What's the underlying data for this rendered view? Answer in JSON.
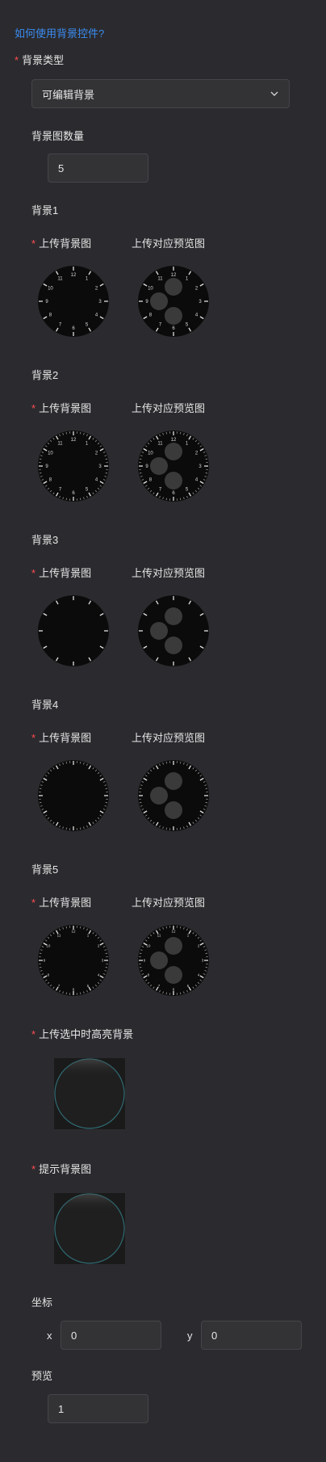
{
  "help_link": "如何使用背景控件?",
  "background_type": {
    "label": "背景类型",
    "value": "可编辑背景"
  },
  "background_count": {
    "label": "背景图数量",
    "value": "5"
  },
  "backgrounds": [
    {
      "title": "背景1",
      "upload_label": "上传背景图",
      "preview_label": "上传对应预览图",
      "dial_style": "numbered"
    },
    {
      "title": "背景2",
      "upload_label": "上传背景图",
      "preview_label": "上传对应预览图",
      "dial_style": "numbered-fine"
    },
    {
      "title": "背景3",
      "upload_label": "上传背景图",
      "preview_label": "上传对应预览图",
      "dial_style": "plain"
    },
    {
      "title": "背景4",
      "upload_label": "上传背景图",
      "preview_label": "上传对应预览图",
      "dial_style": "minute-ticks"
    },
    {
      "title": "背景5",
      "upload_label": "上传背景图",
      "preview_label": "上传对应预览图",
      "dial_style": "numbered-small"
    }
  ],
  "highlight_background": {
    "label": "上传选中时高亮背景"
  },
  "hint_background": {
    "label": "提示背景图"
  },
  "coordinates": {
    "label": "坐标",
    "x_label": "x",
    "x_value": "0",
    "y_label": "y",
    "y_value": "0"
  },
  "preview": {
    "label": "预览",
    "value": "1"
  },
  "dial_numbers": [
    "12",
    "1",
    "2",
    "3",
    "4",
    "5",
    "6",
    "7",
    "8",
    "9",
    "10",
    "11"
  ],
  "colors": {
    "page_bg": "#2b2b2f",
    "accent": "#3b8cf0",
    "required": "#ff4d4f",
    "dial_face": "#0b0b0b",
    "subdial": "#3a3a3a",
    "circle_outline": "#2f6b73"
  }
}
